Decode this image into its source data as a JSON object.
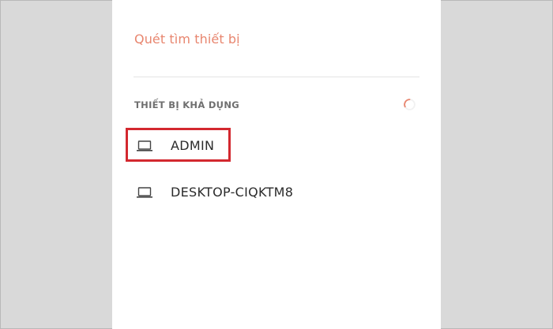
{
  "scan": {
    "label": "Quét tìm thiết bị"
  },
  "available": {
    "header": "THIẾT BỊ KHẢ DỤNG"
  },
  "devices": [
    {
      "name": "ADMIN",
      "icon": "laptop-icon"
    },
    {
      "name": "DESKTOP-CIQKTM8",
      "icon": "laptop-icon"
    }
  ],
  "colors": {
    "accent": "#e8866f",
    "highlight": "#d3282f",
    "background": "#d9d9d9",
    "panel": "#ffffff"
  }
}
